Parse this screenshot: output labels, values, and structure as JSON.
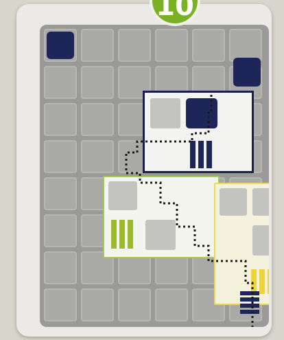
{
  "level": {
    "number": "10",
    "color": "#7bb125"
  },
  "board": {
    "background_color": "#9a9a98",
    "cell_color": "#a9a9a6",
    "anchor_color": "#1e2559",
    "grid_columns": 6,
    "grid_rows": 8
  },
  "pieces": [
    {
      "name": "navy-piece",
      "color": "#1a1f4a"
    },
    {
      "name": "green-piece",
      "color": "#a8c84e"
    },
    {
      "name": "yellow-piece",
      "color": "#f0d75a"
    }
  ],
  "path": {
    "style": "dotted",
    "color": "#1a1a1a"
  }
}
